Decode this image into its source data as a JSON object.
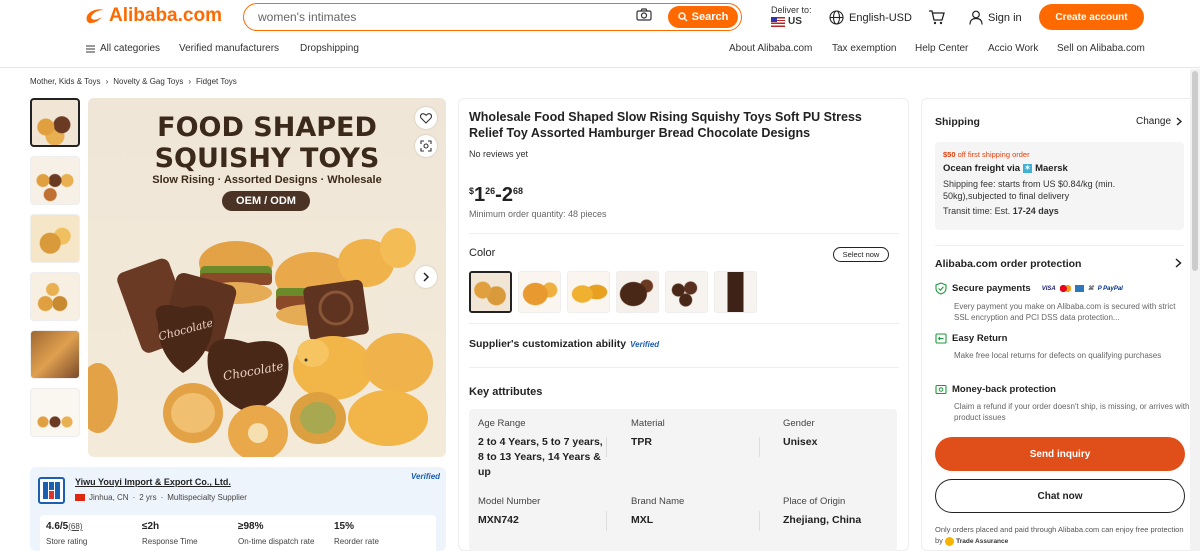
{
  "header": {
    "logo": "Alibaba.com",
    "search_value": "women's intimates",
    "search_button": "Search",
    "deliver_to_label": "Deliver to:",
    "deliver_country": "US",
    "language": "English-USD",
    "sign_in": "Sign in",
    "create_account": "Create account"
  },
  "nav": {
    "left": [
      "All categories",
      "Verified manufacturers",
      "Dropshipping"
    ],
    "right": [
      "About Alibaba.com",
      "Tax exemption",
      "Help Center",
      "Accio Work",
      "Sell on Alibaba.com"
    ]
  },
  "breadcrumb": [
    "Mother, Kids & Toys",
    "Novelty & Gag Toys",
    "Fidget Toys"
  ],
  "hero": {
    "title_line1": "FOOD SHAPED",
    "title_line2": "SQUISHY TOYS",
    "subtitle": "Slow Rising · Assorted Designs · Wholesale",
    "badge": "OEM / ODM"
  },
  "supplier": {
    "name": "Yiwu Youyi Import & Export Co., Ltd.",
    "location": "Jinhua, CN",
    "years": "2 yrs",
    "type": "Multispecialty Supplier",
    "verified": "Verified",
    "stats": [
      {
        "value": "4.6/5",
        "extra": "(68)",
        "label": "Store rating"
      },
      {
        "value": "≤2h",
        "extra": "",
        "label": "Response Time"
      },
      {
        "value": "≥98%",
        "extra": "",
        "label": "On-time dispatch rate"
      },
      {
        "value": "15%",
        "extra": "",
        "label": "Reorder rate"
      }
    ]
  },
  "product": {
    "title": "Wholesale Food Shaped Slow Rising Squishy Toys Soft PU Stress Relief Toy Assorted Hamburger Bread Chocolate Designs",
    "reviews": "No reviews yet",
    "price_currency": "$",
    "price_low_int": "1",
    "price_low_dec": "26",
    "price_sep": "-",
    "price_high_int": "2",
    "price_high_dec": "68",
    "moq": "Minimum order quantity: 48 pieces",
    "color_label": "Color",
    "select_now": "Select now",
    "customization": "Supplier's customization ability",
    "customization_badge": "Verified",
    "key_attributes_label": "Key attributes",
    "attributes": [
      {
        "key": "Age Range",
        "value": "2 to 4 Years, 5 to 7 years, 8 to 13 Years, 14 Years & up"
      },
      {
        "key": "Material",
        "value": "TPR"
      },
      {
        "key": "Gender",
        "value": "Unisex"
      },
      {
        "key": "Model Number",
        "value": "MXN742"
      },
      {
        "key": "Brand Name",
        "value": "MXL"
      },
      {
        "key": "Place of Origin",
        "value": "Zhejiang, China"
      }
    ]
  },
  "shipping": {
    "title": "Shipping",
    "change": "Change",
    "offer_amount": "$50",
    "offer_text": " off first shipping order",
    "freight_prefix": "Ocean freight via",
    "freight_carrier": "Maersk",
    "fee": "Shipping fee: starts from US $0.84/kg (min. 50kg),subjected to final delivery",
    "transit_prefix": "Transit time: Est. ",
    "transit_days": "17-24 days"
  },
  "protection": {
    "title": "Alibaba.com order protection",
    "secure_title": "Secure payments",
    "pay_methods": [
      "VISA",
      "MC",
      "AE",
      "PP"
    ],
    "secure_desc": "Every payment you make on Alibaba.com is secured with strict SSL encryption and PCI DSS data protection...",
    "return_title": "Easy Return",
    "return_desc": "Make free local returns for defects on qualifying purchases",
    "refund_title": "Money-back protection",
    "refund_desc": "Claim a refund if your order doesn't ship, is missing, or arrives with product issues"
  },
  "actions": {
    "send_inquiry": "Send inquiry",
    "chat_now": "Chat now",
    "footnote": "Only orders placed and paid through Alibaba.com can enjoy free protection by",
    "trade_assurance": "Trade Assurance"
  },
  "colors": {
    "accent": "#ff6a00",
    "inquiry": "#e04f1a",
    "verified": "#1c5fb0"
  }
}
